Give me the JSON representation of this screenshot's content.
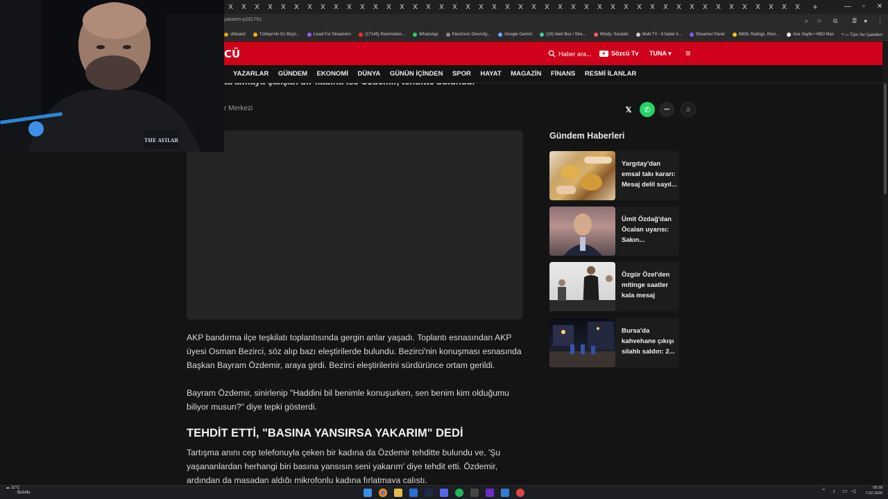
{
  "browser": {
    "tab_glyph": "X",
    "tab_count": 44,
    "new_tab": "+",
    "url": "yakarim-p291751",
    "bookmarks": [
      {
        "label": "shboard",
        "color": "#e9a100"
      },
      {
        "label": "Türkiye'nin En Büyü...",
        "color": "#f2b400"
      },
      {
        "label": "Livad For Streamers",
        "color": "#9b59ff"
      },
      {
        "label": "(17145) Rammstein...",
        "color": "#ff2a2a"
      },
      {
        "label": "WhatsApp",
        "color": "#25d366"
      },
      {
        "label": "Electronic Diversity...",
        "color": "#888888"
      },
      {
        "label": "Google Gemini",
        "color": "#6fa8ff"
      },
      {
        "label": "(19) Alert Box / Stre...",
        "color": "#3ad1a4"
      },
      {
        "label": "Windy: Sıcaklık",
        "color": "#ff5a5a"
      },
      {
        "label": "Multi TV - 6 haber k...",
        "color": "#cccccc"
      },
      {
        "label": "Streamer Panel",
        "color": "#7a5cff"
      },
      {
        "label": "IMDb: Ratings, Revi...",
        "color": "#f5c518"
      },
      {
        "label": "Ana Sayfa • HBO Max",
        "color": "#ffffff"
      }
    ],
    "bookmarks_more": "»",
    "bookmarks_folder": "Tüm Yer İşaretleri"
  },
  "site": {
    "logo": "CÜ",
    "search_placeholder": "Haber ara...",
    "tv_label": "Sözcü Tv",
    "user_label": "TUNA ▾",
    "menu_icon": "≡",
    "nav": [
      "YAZARLAR",
      "GÜNDEM",
      "EKONOMİ",
      "DÜNYA",
      "GÜNÜN İÇİNDEN",
      "SPOR",
      "HAYAT",
      "MAGAZİN",
      "FİNANS",
      "RESMİ İLANLAR"
    ],
    "accent": "#d0021b"
  },
  "article": {
    "cut_line": "ta almaya çalışan bir kadına ise Özdemir, tehditte bulundu.",
    "source": "r Merkezi",
    "share": {
      "x": "𝕏",
      "whatsapp": "✆",
      "more": "•••",
      "font": "a"
    },
    "para1": "AKP bandırma ilçe teşkilatı toplantısında gergin anlar yaşadı. Toplantı esnasından AKP üyesi Osman Bezirci, söz alıp bazı eleştirilerde bulundu. Bezirci'nin konuşması esnasında Başkan Bayram Özdemir, araya girdi. Bezirci eleştirilerini sürdürünce ortam gerildi.",
    "para2": "Bayram Özdemir, sinirlenip \"Haddini bil benimle konuşurken, sen benim kim olduğumu biliyor musun?\" diye tepki gösterdi.",
    "subhead": "TEHDİT ETTİ, \"BASINA YANSIRSA YAKARIM\" DEDİ",
    "para3": "Tartışma anını cep telefonuyla çeken bir kadına da Özdemir tehditte bulundu ve,  'Şu yaşananlardan herhangi biri basına yansısın seni yakarım' diye tehdit etti. Özdemir, ardından da masadan aldığı mikrofonlu kadına fırlatmaya çalıştı."
  },
  "sidebar": {
    "title": "Gündem Haberleri",
    "items": [
      {
        "title": "Yargıtay'dan emsal takı kararı: Mesaj delil sayıl..."
      },
      {
        "title": "Ümit Özdağ'dan Öcalan uyarısı: Sakın..."
      },
      {
        "title": "Özgür Özel'den mitinge saatler kala mesaj"
      },
      {
        "title": "Bursa'da kahvehane çıkışı silahlı saldırı: 2..."
      }
    ]
  },
  "webcam": {
    "shirt_text": "THE AYILAR"
  },
  "taskbar": {
    "temp": "11°C",
    "weather": "Bulutlu",
    "time": "09:39",
    "date": "7.02.2026"
  }
}
